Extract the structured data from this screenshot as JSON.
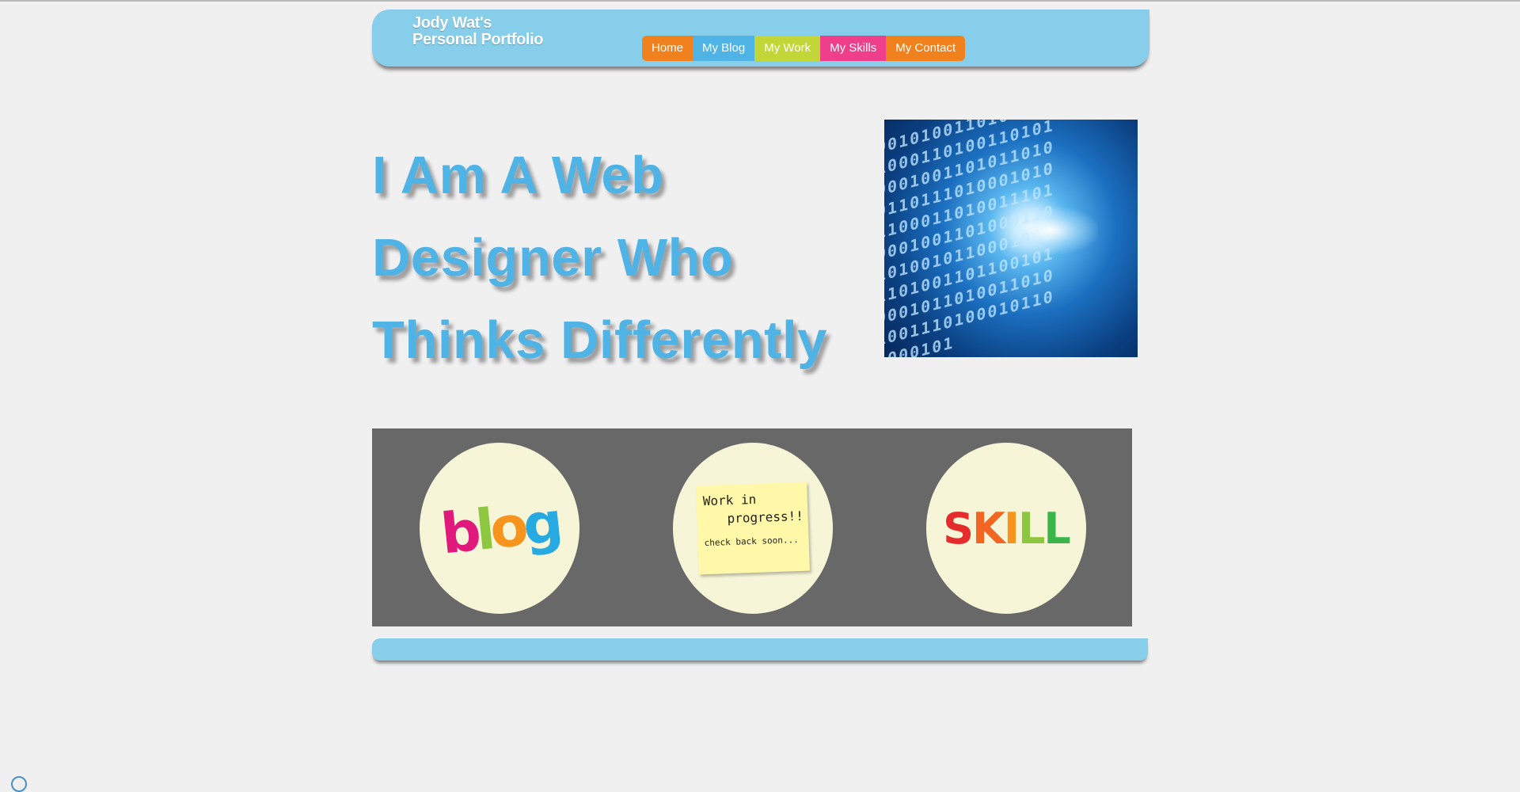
{
  "header": {
    "title_line1": "Jody Wat's",
    "title_line2": "Personal Portfolio"
  },
  "nav": {
    "items": [
      {
        "label": "Home",
        "color": "#f0811c"
      },
      {
        "label": "My Blog",
        "color": "#4fb3e5"
      },
      {
        "label": "My Work",
        "color": "#c2d737"
      },
      {
        "label": "My Skills",
        "color": "#ef3f8a"
      },
      {
        "label": "My Contact",
        "color": "#f0811c"
      }
    ]
  },
  "hero": {
    "line1": "I Am A Web",
    "line2": "Designer Who",
    "line3": "Thinks Differently",
    "image_binary": "00101001101011001000110100110101000100110101101001101110100010101100011010011101000100110100011010100101100010001101001101100101000101101001101010011101000101101000101",
    "color": "#4fb3e5"
  },
  "features": {
    "blog": {
      "letters": [
        "b",
        "l",
        "o",
        "g"
      ],
      "icon": "blog-letters-image"
    },
    "work": {
      "line1": "Work in",
      "line2": "progress!!",
      "line3": "check back soon...",
      "icon": "sticky-note-image"
    },
    "skills": {
      "letters": [
        "S",
        "K",
        "I",
        "L",
        "L"
      ],
      "icon": "skill-letters-image"
    }
  },
  "colors": {
    "header_bg": "#87ceeb",
    "band_bg": "#686868",
    "circle_bg": "#f6f5d8",
    "page_bg": "#f0f0f0"
  }
}
